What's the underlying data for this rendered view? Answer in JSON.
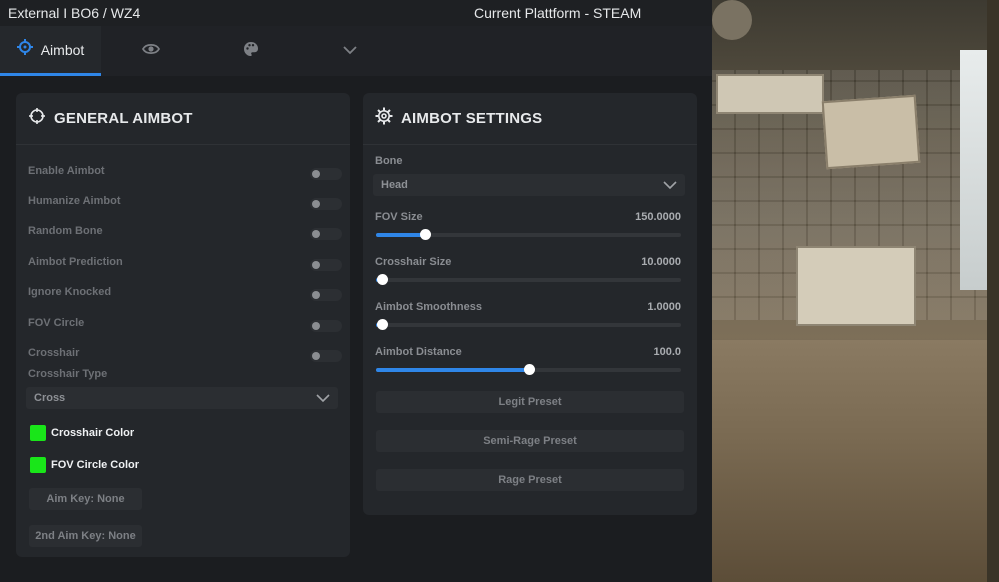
{
  "window": {
    "title": "External I BO6 / WZ4",
    "platform": "Current Plattform - STEAM"
  },
  "tabs": [
    {
      "label": "Aimbot",
      "icon": "crosshair-icon",
      "active": true
    },
    {
      "label": "",
      "icon": "eye-icon",
      "active": false
    },
    {
      "label": "",
      "icon": "palette-icon",
      "active": false
    },
    {
      "label": "",
      "icon": "chevron-down-icon",
      "active": false
    }
  ],
  "general": {
    "title": "GENERAL AIMBOT",
    "toggles": [
      {
        "label": "Enable Aimbot",
        "on": false
      },
      {
        "label": "Humanize Aimbot",
        "on": false
      },
      {
        "label": "Random Bone",
        "on": false
      },
      {
        "label": "Aimbot Prediction",
        "on": false
      },
      {
        "label": "Ignore Knocked",
        "on": false
      },
      {
        "label": "FOV Circle",
        "on": false
      },
      {
        "label": "Crosshair",
        "on": false
      }
    ],
    "crosshair_type_label": "Crosshair Type",
    "crosshair_type_value": "Cross",
    "crosshair_color_label": "Crosshair Color",
    "fov_circle_color_label": "FOV Circle Color",
    "color_value": "#19e619",
    "aim_key": "Aim Key: None",
    "aim_key2": "2nd Aim Key: None"
  },
  "settings": {
    "title": "AIMBOT SETTINGS",
    "bone_label": "Bone",
    "bone_value": "Head",
    "sliders": [
      {
        "label": "FOV Size",
        "value": "150.0000",
        "fraction": 0.16
      },
      {
        "label": "Crosshair Size",
        "value": "10.0000",
        "fraction": 0.02
      },
      {
        "label": "Aimbot Smoothness",
        "value": "1.0000",
        "fraction": 0.02
      },
      {
        "label": "Aimbot Distance",
        "value": "100.0",
        "fraction": 0.5
      }
    ],
    "presets": [
      "Legit Preset",
      "Semi-Rage Preset",
      "Rage Preset"
    ]
  },
  "colors": {
    "accent": "#2f86e8",
    "panel": "#24272b",
    "background": "#1b1d20"
  }
}
